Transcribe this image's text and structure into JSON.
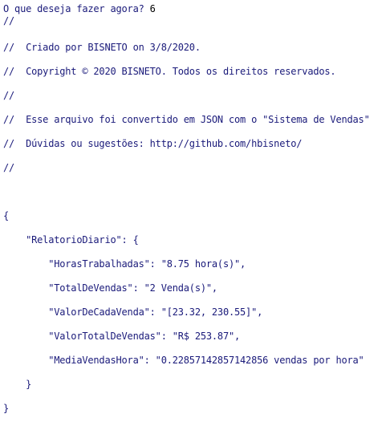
{
  "prompt": {
    "question": "O que deseja fazer agora? ",
    "answer": "6"
  },
  "header_comments": [
    "//",
    "//  Criado por BISNETO on 3/8/2020.",
    "//  Copyright © 2020 BISNETO. Todos os direitos reservados.",
    "//",
    "//  Esse arquivo foi convertido em JSON com o \"Sistema de Vendas\"",
    "//  Dúvidas ou sugestões: http://github.com/hbisneto/",
    "//"
  ],
  "json_lines": [
    "{",
    "    \"RelatorioDiario\": {",
    "        \"HorasTrabalhadas\": \"8.75 hora(s)\",",
    "        \"TotalDeVendas\": \"2 Venda(s)\",",
    "        \"ValorDeCadaVenda\": \"[23.32, 230.55]\",",
    "        \"ValorTotalDeVendas\": \"R$ 253.87\",",
    "        \"MediaVendasHora\": \"0.22857142857142856 vendas por hora\"",
    "    }",
    "}"
  ],
  "colors": {
    "text": "#1a1a7a",
    "answer": "#000000",
    "background": "#ffffff"
  }
}
